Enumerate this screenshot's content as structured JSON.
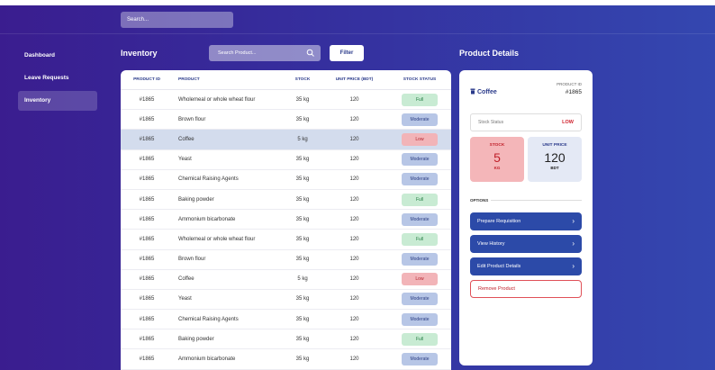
{
  "topbar": {
    "search_placeholder": "Search..."
  },
  "sidebar": {
    "items": [
      {
        "label": "Dashboard",
        "active": false
      },
      {
        "label": "Leave Requests",
        "active": false
      },
      {
        "label": "Inventory",
        "active": true
      }
    ]
  },
  "inventory": {
    "title": "Inventory",
    "search_placeholder": "Search Product...",
    "filter_label": "Filter",
    "columns": [
      "PRODUCT ID",
      "PRODUCT",
      "STOCK",
      "UNIT PRICE (BDT)",
      "STOCK STATUS"
    ],
    "rows": [
      {
        "id": "#1865",
        "product": "Wholemeal or whole wheat flour",
        "stock": "35 kg",
        "price": "120",
        "status": "Full"
      },
      {
        "id": "#1865",
        "product": "Brown flour",
        "stock": "35 kg",
        "price": "120",
        "status": "Moderate"
      },
      {
        "id": "#1865",
        "product": "Coffee",
        "stock": "5 kg",
        "price": "120",
        "status": "Low",
        "selected": true
      },
      {
        "id": "#1865",
        "product": "Yeast",
        "stock": "35 kg",
        "price": "120",
        "status": "Moderate"
      },
      {
        "id": "#1865",
        "product": "Chemical Raising Agents",
        "stock": "35 kg",
        "price": "120",
        "status": "Moderate"
      },
      {
        "id": "#1865",
        "product": "Baking powder",
        "stock": "35 kg",
        "price": "120",
        "status": "Full"
      },
      {
        "id": "#1865",
        "product": "Ammonium bicarbonate",
        "stock": "35 kg",
        "price": "120",
        "status": "Moderate"
      },
      {
        "id": "#1865",
        "product": "Wholemeal or whole wheat flour",
        "stock": "35 kg",
        "price": "120",
        "status": "Full"
      },
      {
        "id": "#1865",
        "product": "Brown flour",
        "stock": "35 kg",
        "price": "120",
        "status": "Moderate"
      },
      {
        "id": "#1865",
        "product": "Coffee",
        "stock": "5 kg",
        "price": "120",
        "status": "Low"
      },
      {
        "id": "#1865",
        "product": "Yeast",
        "stock": "35 kg",
        "price": "120",
        "status": "Moderate"
      },
      {
        "id": "#1865",
        "product": "Chemical Raising Agents",
        "stock": "35 kg",
        "price": "120",
        "status": "Moderate"
      },
      {
        "id": "#1865",
        "product": "Baking powder",
        "stock": "35 kg",
        "price": "120",
        "status": "Full"
      },
      {
        "id": "#1865",
        "product": "Ammonium bicarbonate",
        "stock": "35 kg",
        "price": "120",
        "status": "Moderate"
      }
    ]
  },
  "details": {
    "title": "Product Details",
    "product_name": "Coffee",
    "product_icon": "product-icon",
    "product_id_label": "PRODUCT ID",
    "product_id": "#1865",
    "stock_status_label": "Stock Status",
    "stock_status_value": "LOW",
    "stock_label": "STOCK",
    "stock_value": "5",
    "stock_unit": "KG",
    "price_label": "UNIT PRICE",
    "price_value": "120",
    "price_unit": "BDT",
    "options_label": "OPTIONS",
    "options": [
      {
        "label": "Prepare Requisition",
        "kind": "primary"
      },
      {
        "label": "View History",
        "kind": "primary"
      },
      {
        "label": "Edit Product Details",
        "kind": "primary"
      }
    ],
    "remove_label": "Remove Product"
  },
  "colors": {
    "primary": "#2c4aa8",
    "full": "#c8ebd3",
    "moderate": "#b7c6e6",
    "low": "#f2b4b8"
  }
}
